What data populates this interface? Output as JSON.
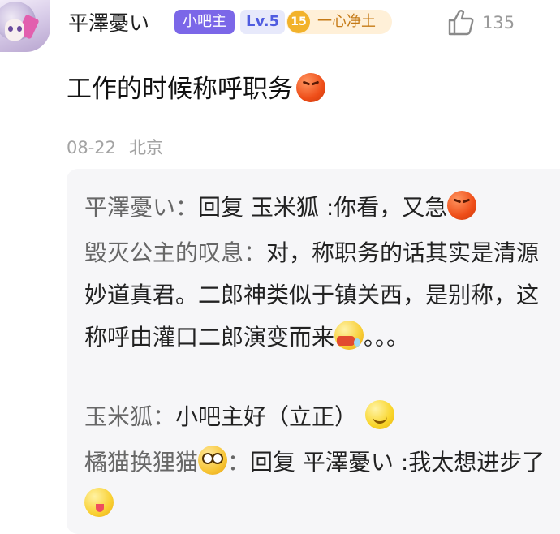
{
  "post": {
    "username": "平澤憂い",
    "badges": {
      "admin": "小吧主",
      "level": "Lv.5",
      "fan_level": "15",
      "fan_title": "一心净土"
    },
    "likes": "135",
    "text": "工作的时候称呼职务",
    "date": "08-22",
    "location": "北京"
  },
  "replies": [
    {
      "name": "平澤憂い",
      "sep": "：",
      "text": "回复 玉米狐 :你看，又急",
      "emoji": "angry"
    },
    {
      "name": "毁灭公主的叹息",
      "sep": "：",
      "text": "对，称职务的话其实是清源妙道真君。二郎神类似于镇关西，是别称，这称呼由灌口二郎演变而来",
      "emoji": "drool",
      "tail": "。。。"
    },
    {
      "name": "玉米狐",
      "sep": "：",
      "text": "小吧主好（立正）",
      "emoji": "smile"
    },
    {
      "name": "橘猫换狸猫",
      "name_emoji": "flushed",
      "sep": "：",
      "text": "回复 平澤憂い :我太想进步了",
      "emoji": "yum"
    }
  ],
  "icons": {
    "avatar": "user-avatar",
    "like": "thumbs-up-icon"
  },
  "colors": {
    "admin_badge": "#7b67e8",
    "level_badge": "#4f5ce0",
    "fan_badge": "#f2b22b",
    "reply_bg": "#f6f6f8",
    "meta": "#a3a3a3"
  }
}
